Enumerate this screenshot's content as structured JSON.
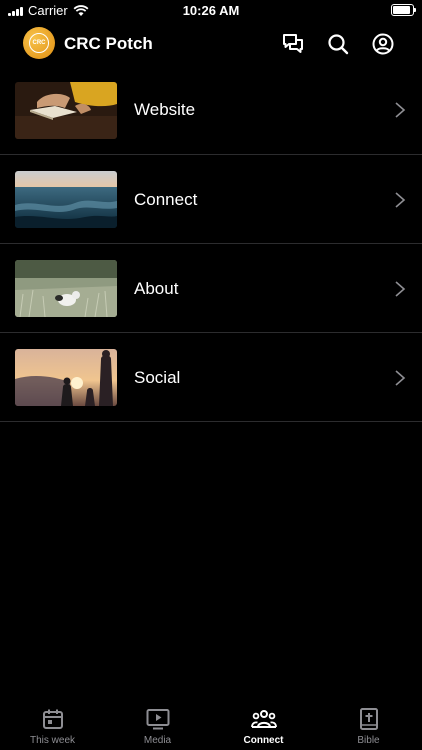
{
  "status_bar": {
    "carrier": "Carrier",
    "time": "10:26 AM",
    "battery_level": 0.9
  },
  "header": {
    "logo_text": "CRC",
    "title": "CRC Potch",
    "icons": [
      "chat-bubbles-icon",
      "search-icon",
      "profile-icon"
    ]
  },
  "list": [
    {
      "label": "Website",
      "thumbnail": "person-reading-book-photo"
    },
    {
      "label": "Connect",
      "thumbnail": "ocean-wave-photo"
    },
    {
      "label": "About",
      "thumbnail": "dog-in-field-photo"
    },
    {
      "label": "Social",
      "thumbnail": "friends-at-sunset-photo"
    }
  ],
  "tabs": [
    {
      "label": "This week",
      "icon": "calendar-icon",
      "active": false
    },
    {
      "label": "Media",
      "icon": "play-screen-icon",
      "active": false
    },
    {
      "label": "Connect",
      "icon": "people-group-icon",
      "active": true
    },
    {
      "label": "Bible",
      "icon": "bible-book-icon",
      "active": false
    }
  ],
  "colors": {
    "background": "#000000",
    "divider": "#2c2c2e",
    "inactive_tab": "#8e8e93",
    "logo": "#f0a523"
  }
}
